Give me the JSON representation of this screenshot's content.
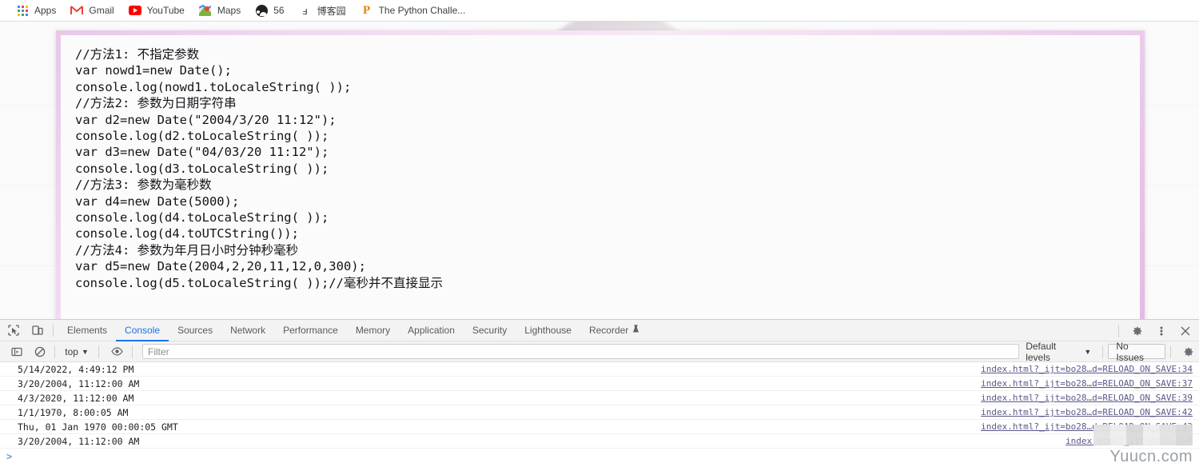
{
  "bookmark_bar": {
    "items": [
      {
        "label": "Apps",
        "icon": "apps-grid-icon"
      },
      {
        "label": "Gmail",
        "icon": "gmail-icon"
      },
      {
        "label": "YouTube",
        "icon": "youtube-icon"
      },
      {
        "label": "Maps",
        "icon": "maps-icon"
      },
      {
        "label": "56",
        "icon": "avatar-icon"
      },
      {
        "label": "博客园",
        "icon": "cnblogs-icon"
      },
      {
        "label": "The Python Challe...",
        "icon": "python-challenge-icon"
      }
    ]
  },
  "page": {
    "code_lines": [
      "//方法1: 不指定参数",
      "var nowd1=new Date();",
      "console.log(nowd1.toLocaleString( ));",
      "//方法2: 参数为日期字符串",
      "var d2=new Date(\"2004/3/20 11:12\");",
      "console.log(d2.toLocaleString( ));",
      "var d3=new Date(\"04/03/20 11:12\");",
      "console.log(d3.toLocaleString( ));",
      "//方法3: 参数为毫秒数",
      "var d4=new Date(5000);",
      "console.log(d4.toLocaleString( ));",
      "console.log(d4.toUTCString());",
      "//方法4: 参数为年月日小时分钟秒毫秒",
      "var d5=new Date(2004,2,20,11,12,0,300);",
      "console.log(d5.toLocaleString( ));//毫秒并不直接显示"
    ]
  },
  "devtools": {
    "left_icons": [
      {
        "name": "inspect-element-icon"
      },
      {
        "name": "device-toolbar-icon"
      }
    ],
    "tabs": [
      {
        "label": "Elements",
        "active": false
      },
      {
        "label": "Console",
        "active": true
      },
      {
        "label": "Sources",
        "active": false
      },
      {
        "label": "Network",
        "active": false
      },
      {
        "label": "Performance",
        "active": false
      },
      {
        "label": "Memory",
        "active": false
      },
      {
        "label": "Application",
        "active": false
      },
      {
        "label": "Security",
        "active": false
      },
      {
        "label": "Lighthouse",
        "active": false
      },
      {
        "label": "Recorder",
        "active": false,
        "badge": "experiment-flask-icon"
      }
    ],
    "right_icons": [
      {
        "name": "settings-gear-icon"
      },
      {
        "name": "more-options-icon"
      },
      {
        "name": "close-devtools-icon"
      }
    ],
    "toolbar": {
      "sidebar_toggle": "console-sidebar-icon",
      "clear_console": "clear-console-icon",
      "context": "top",
      "context_caret": "▼",
      "eye_icon": "live-expression-eye-icon",
      "filter_placeholder": "Filter",
      "filter_value": "",
      "levels_label": "Default levels",
      "levels_caret": "▼",
      "issues_label": "No Issues",
      "settings_icon": "console-settings-gear-icon"
    },
    "console_rows": [
      {
        "message": "5/14/2022, 4:49:12 PM",
        "source": "index.html?_ijt=bo28…d=RELOAD_ON_SAVE:34"
      },
      {
        "message": "3/20/2004, 11:12:00 AM",
        "source": "index.html?_ijt=bo28…d=RELOAD_ON_SAVE:37"
      },
      {
        "message": "4/3/2020, 11:12:00 AM",
        "source": "index.html?_ijt=bo28…d=RELOAD_ON_SAVE:39"
      },
      {
        "message": "1/1/1970, 8:00:05 AM",
        "source": "index.html?_ijt=bo28…d=RELOAD_ON_SAVE:42"
      },
      {
        "message": "Thu, 01 Jan 1970 00:00:05 GMT",
        "source": "index.html?_ijt=bo28…d=RELOAD_ON_SAVE:43"
      },
      {
        "message": "3/20/2004, 11:12:00 AM",
        "source": "index.html?_ijt=bo28…d=R"
      }
    ],
    "prompt": ">"
  },
  "watermark": {
    "text": "Yuucn.com"
  },
  "colors": {
    "accent": "#1a73e8",
    "panel_border": "#e2bbe4",
    "link": "#5a5a8a"
  }
}
